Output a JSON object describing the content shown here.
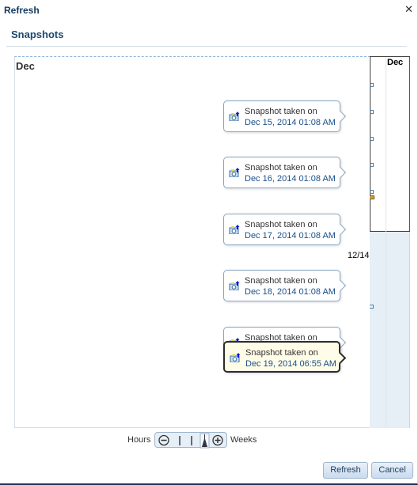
{
  "dialog": {
    "title": "Refresh",
    "close_icon": "close-icon"
  },
  "section": {
    "title": "Snapshots"
  },
  "timeline": {
    "month_label": "Dec",
    "events": [
      {
        "label": "Snapshot taken on",
        "date": "Dec 15, 2014 01:08 AM",
        "selected": false
      },
      {
        "label": "Snapshot taken on",
        "date": "Dec 16, 2014 01:08 AM",
        "selected": false
      },
      {
        "label": "Snapshot taken on",
        "date": "Dec 17, 2014 01:08 AM",
        "selected": false
      },
      {
        "label": "Snapshot taken on",
        "date": "Dec 18, 2014 01:08 AM",
        "selected": false
      },
      {
        "label": "Snapshot taken on",
        "date": "",
        "selected": false
      },
      {
        "label": "Snapshot taken on",
        "date": "Dec 19, 2014 06:55 AM",
        "selected": true
      }
    ],
    "date_label": "12/14"
  },
  "overview": {
    "month_label": "Dec"
  },
  "zoom": {
    "min_label": "Hours",
    "max_label": "Weeks",
    "level": "Weeks"
  },
  "buttons": {
    "refresh": "Refresh",
    "cancel": "Cancel"
  },
  "colors": {
    "accent": "#1d4870",
    "selected_bg": "#fffce8"
  }
}
